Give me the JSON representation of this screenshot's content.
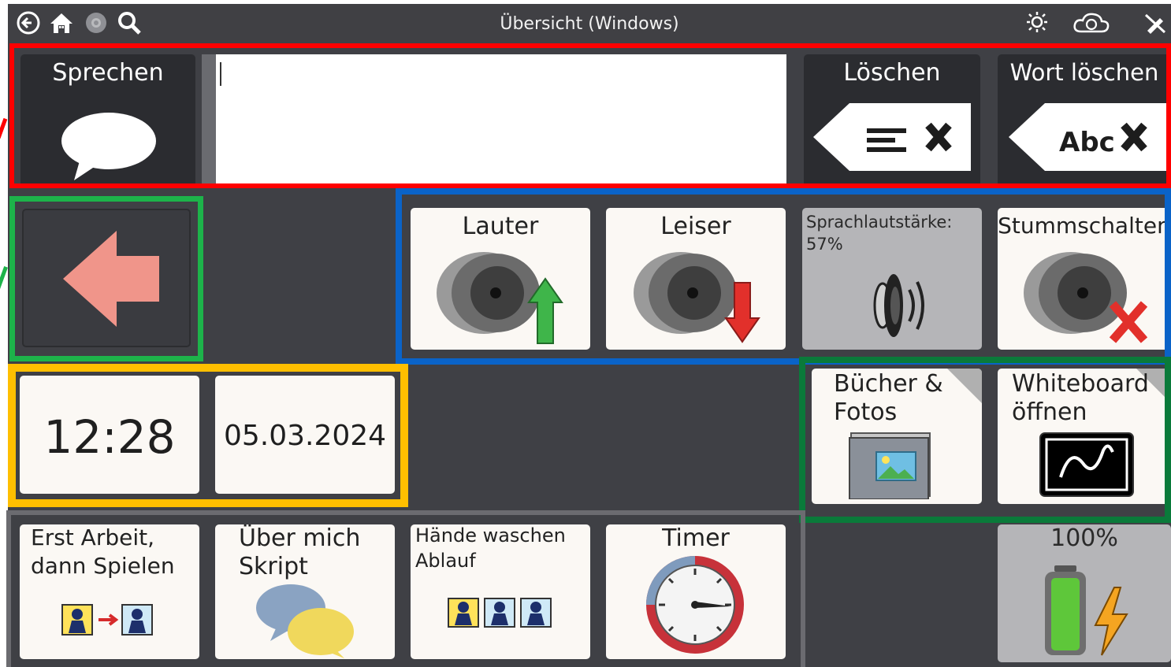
{
  "topbar": {
    "title": "Übersicht (Windows)",
    "icons": [
      "back-icon",
      "home-icon",
      "settings-gear-icon",
      "search-icon",
      "brightness-icon",
      "cloud-sync-icon",
      "edit-off-icon"
    ]
  },
  "message_bar": {
    "speak_label": "Sprechen",
    "text_value": "",
    "clear_label": "Löschen",
    "delete_word_label": "Wort löschen",
    "delete_word_icon_text": "Abc"
  },
  "volume": {
    "louder_label": "Lauter",
    "quieter_label": "Leiser",
    "speech_volume_label": "Sprachlautstärke:",
    "speech_volume_value": "57%",
    "mute_label": "Stummschalten"
  },
  "clock": {
    "time": "12:28",
    "date": "05.03.2024"
  },
  "apps": {
    "books_label_1": "Bücher &",
    "books_label_2": "Fotos",
    "whiteboard_label_1": "Whiteboard",
    "whiteboard_label_2": "öffnen"
  },
  "shortcuts": {
    "first_then_1": "Erst Arbeit,",
    "first_then_2": "dann Spielen",
    "about_me_1": "Über mich",
    "about_me_2": "Skript",
    "handwash_1": "Hände waschen",
    "handwash_2": "Ablauf",
    "timer_label": "Timer",
    "battery_label": "100%"
  },
  "highlight_colors": {
    "red": "#ff0000",
    "green_nav": "#1db34a",
    "blue": "#0a63c8",
    "yellow": "#ffbf00",
    "green_apps": "#0a7a3a",
    "grey": "#6b6b70"
  }
}
